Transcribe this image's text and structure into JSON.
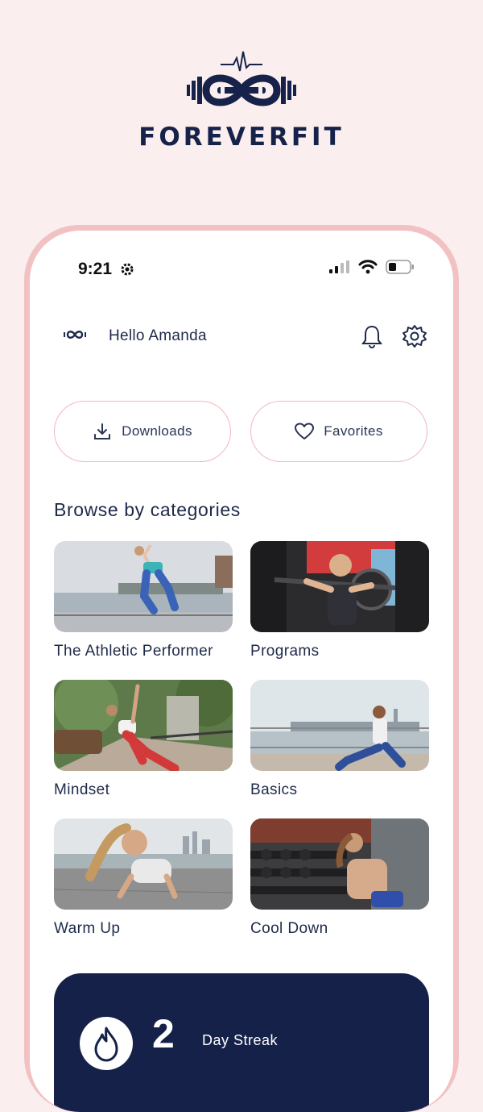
{
  "brand": {
    "name": "FOREVERFIT",
    "logo_icon": "infinity-dumbbell-heartbeat-icon"
  },
  "status_bar": {
    "time": "9:21",
    "icons": [
      "signal-icon",
      "wifi-icon",
      "battery-icon"
    ]
  },
  "header": {
    "greeting": "Hello Amanda",
    "icons": [
      "bell-icon",
      "settings-icon"
    ]
  },
  "actions": [
    {
      "label": "Downloads",
      "icon": "download-icon"
    },
    {
      "label": "Favorites",
      "icon": "heart-icon"
    }
  ],
  "categories": {
    "title": "Browse by categories",
    "items": [
      {
        "label": "The Athletic Performer"
      },
      {
        "label": "Programs"
      },
      {
        "label": "Mindset"
      },
      {
        "label": "Basics"
      },
      {
        "label": "Warm Up"
      },
      {
        "label": "Cool Down"
      }
    ]
  },
  "streak": {
    "value": "2",
    "label": "Day Streak",
    "icon": "flame-icon"
  },
  "colors": {
    "navy": "#152149",
    "pink": "#f2c1c4",
    "background": "#fbeeee"
  }
}
